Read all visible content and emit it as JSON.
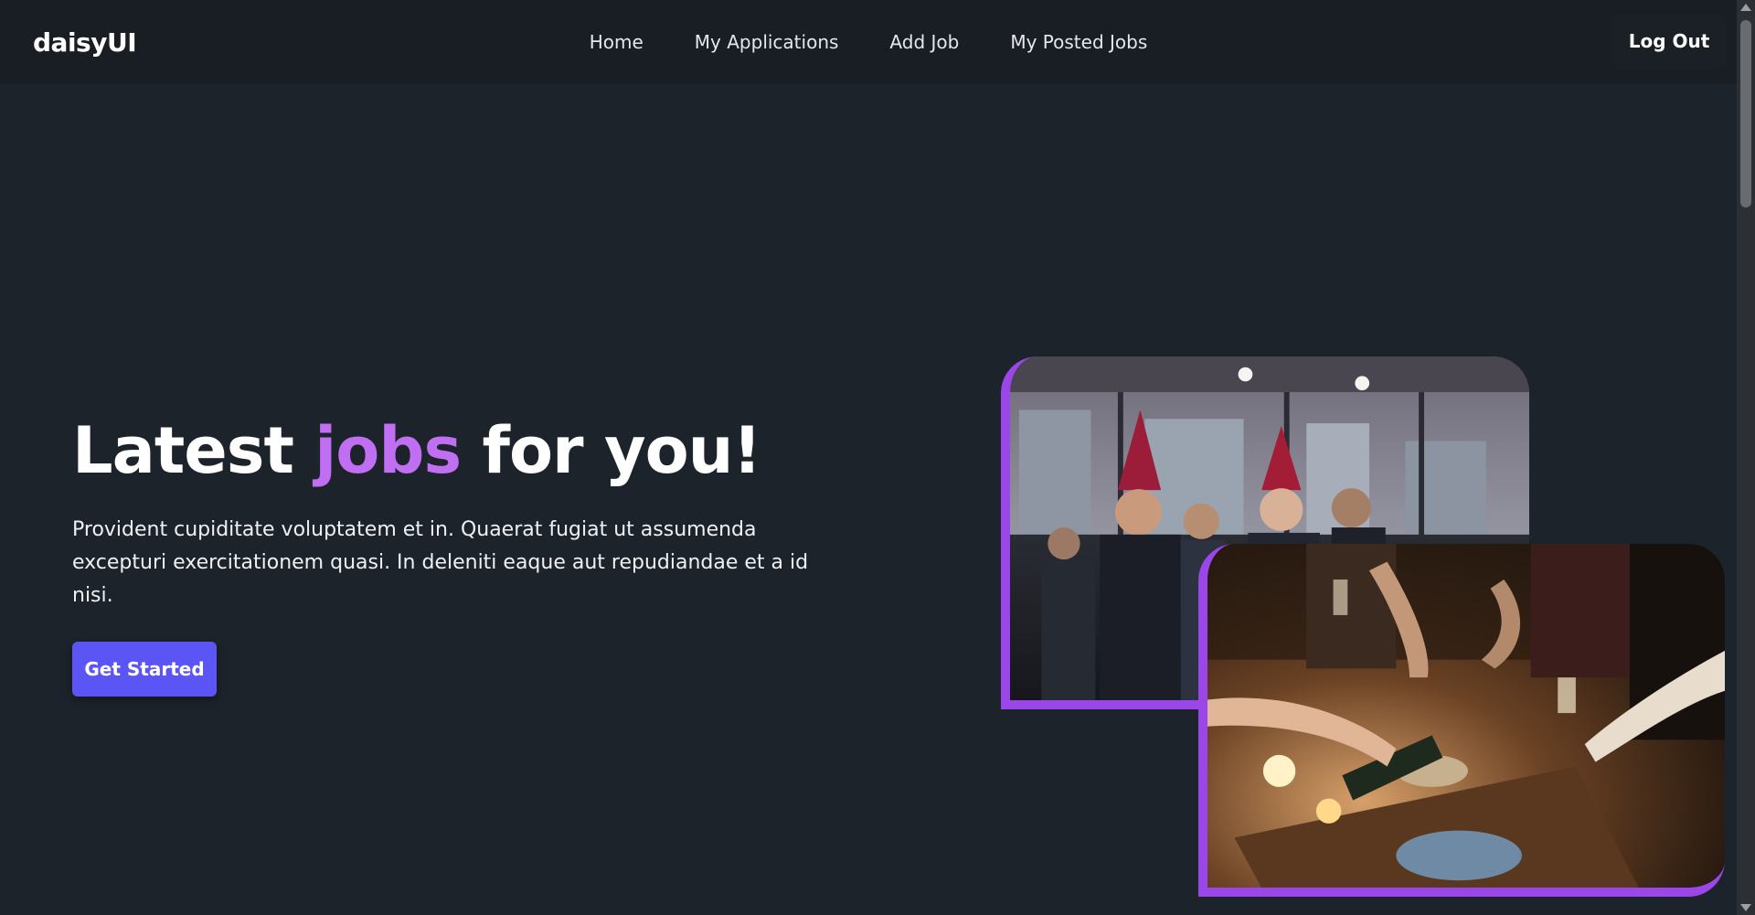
{
  "navbar": {
    "brand": "daisyUI",
    "links": [
      "Home",
      "My Applications",
      "Add Job",
      "My Posted Jobs"
    ],
    "logout_label": "Log Out"
  },
  "hero": {
    "title_start": "Latest ",
    "title_accent": "jobs",
    "title_end": " for you!",
    "description": "Provident cupiditate voluptatem et in. Quaerat fugiat ut assumenda excepturi exercitationem quasi. In deleniti eaque aut repudiandae et a id nisi.",
    "cta_label": "Get Started"
  },
  "colors": {
    "background": "#1d232a",
    "navbar": "#191e24",
    "accent": "#c06ef2",
    "frame_border": "#9b46e8",
    "button": "#5b55f5"
  },
  "icons": {
    "scroll_up": "scroll-up-arrow-icon",
    "scroll_down": "scroll-down-arrow-icon"
  }
}
